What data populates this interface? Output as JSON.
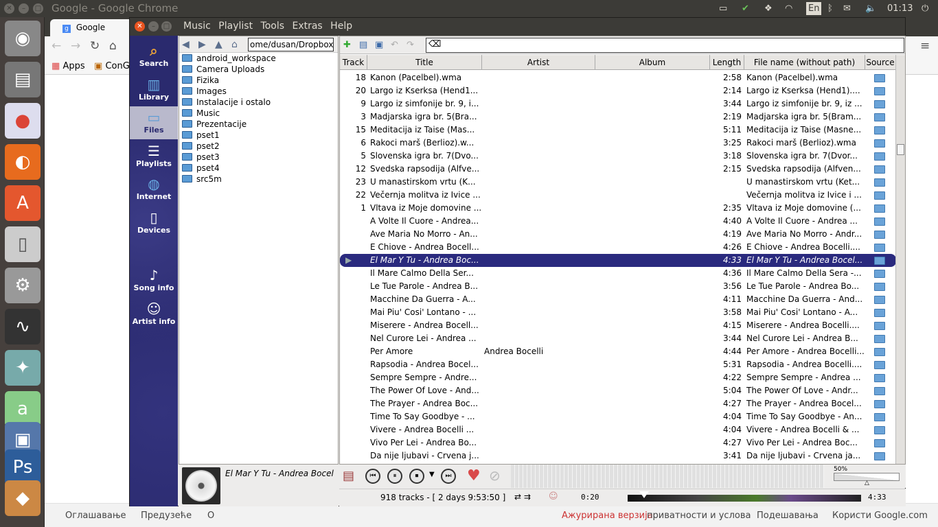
{
  "system": {
    "window_title": "Google - Google Chrome",
    "keyboard": "En",
    "clock": "01:13"
  },
  "launcher": {
    "apps": [
      "ubuntu-icon",
      "files-icon",
      "chrome-icon",
      "firefox-icon",
      "software-center-icon",
      "text-editor-icon",
      "settings-icon",
      "system-monitor-icon",
      "windows-icon",
      "android-icon",
      "vm-icon",
      "photoshop-icon",
      "app-icon"
    ]
  },
  "chrome": {
    "tab_title": "Google",
    "bookmarks": {
      "apps": "Apps",
      "item2": "ConG"
    },
    "footer": {
      "left": [
        "Оглашавање",
        "Предузеће",
        "О"
      ],
      "highlight": "Ажурирана верзија",
      "privacy": "приватности и услова",
      "settings": "Подешавања",
      "use": "Користи Google.com"
    }
  },
  "player": {
    "menu": [
      "Music",
      "Playlist",
      "Tools",
      "Extras",
      "Help"
    ],
    "sidebar": [
      {
        "label": "Search",
        "icon": "search-icon"
      },
      {
        "label": "Library",
        "icon": "library-icon"
      },
      {
        "label": "Files",
        "icon": "files-icon",
        "active": true
      },
      {
        "label": "Playlists",
        "icon": "playlists-icon"
      },
      {
        "label": "Internet",
        "icon": "internet-icon"
      },
      {
        "label": "Devices",
        "icon": "devices-icon"
      },
      {
        "label": "Song info",
        "icon": "song-info-icon"
      },
      {
        "label": "Artist info",
        "icon": "artist-info-icon"
      }
    ],
    "path": "ome/dusan/Dropbox",
    "folders": [
      "android_workspace",
      "Camera Uploads",
      "Fizika",
      "Images",
      "Instalacije i ostalo",
      "Music",
      "Prezentacije",
      "pset1",
      "pset2",
      "pset3",
      "pset4",
      "src5m"
    ],
    "columns": {
      "track": "Track",
      "title": "Title",
      "artist": "Artist",
      "album": "Album",
      "length": "Length",
      "file": "File name (without path)",
      "source": "Source"
    },
    "rows": [
      {
        "track": "18",
        "title": "Kanon (Pacelbel).wma",
        "artist": "",
        "length": "2:58",
        "file": "Kanon (Pacelbel).wma"
      },
      {
        "track": "20",
        "title": "Largo iz Kserksa (Hend1...",
        "artist": "",
        "length": "2:14",
        "file": "Largo iz Kserksa (Hend1)...."
      },
      {
        "track": "9",
        "title": "Largo iz simfonije br. 9, i...",
        "artist": "",
        "length": "3:44",
        "file": "Largo iz simfonije br. 9, iz ..."
      },
      {
        "track": "3",
        "title": "Madjarska igra br. 5(Bra...",
        "artist": "",
        "length": "2:19",
        "file": "Madjarska igra br. 5(Bram..."
      },
      {
        "track": "15",
        "title": "Meditacija iz Taise (Mas...",
        "artist": "",
        "length": "5:11",
        "file": "Meditacija iz Taise (Masne..."
      },
      {
        "track": "6",
        "title": "Rakoci marš (Berlioz).w...",
        "artist": "",
        "length": "3:25",
        "file": "Rakoci marš (Berlioz).wma"
      },
      {
        "track": "5",
        "title": "Slovenska igra br. 7(Dvo...",
        "artist": "",
        "length": "3:18",
        "file": "Slovenska igra br. 7(Dvor..."
      },
      {
        "track": "12",
        "title": "Svedska rapsodija (Alfve...",
        "artist": "",
        "length": "2:15",
        "file": "Svedska rapsodija (Alfven..."
      },
      {
        "track": "23",
        "title": "U manastirskom vrtu (K...",
        "artist": "",
        "length": "",
        "file": "U manastirskom vrtu (Ket..."
      },
      {
        "track": "22",
        "title": "Večernja molitva iz Ivice ...",
        "artist": "",
        "length": "",
        "file": "Večernja molitva iz Ivice i ..."
      },
      {
        "track": "1",
        "title": "Vltava iz Moje domovine ...",
        "artist": "",
        "length": "2:35",
        "file": "Vltava iz Moje domovine (..."
      },
      {
        "track": "",
        "title": "A Volte Il Cuore - Andrea...",
        "artist": "",
        "length": "4:40",
        "file": "A Volte Il Cuore - Andrea ..."
      },
      {
        "track": "",
        "title": "Ave Maria No Morro - An...",
        "artist": "",
        "length": "4:19",
        "file": "Ave Maria No Morro - Andr..."
      },
      {
        "track": "",
        "title": "E Chiove - Andrea Bocell...",
        "artist": "",
        "length": "4:26",
        "file": "E Chiove - Andrea Bocelli...."
      },
      {
        "track": "",
        "title": "El Mar Y Tu - Andrea Boc...",
        "artist": "",
        "length": "4:33",
        "file": "El Mar Y Tu - Andrea Bocel...",
        "playing": true
      },
      {
        "track": "",
        "title": "Il Mare Calmo Della Ser...",
        "artist": "",
        "length": "4:36",
        "file": "Il Mare Calmo Della Sera -..."
      },
      {
        "track": "",
        "title": "Le Tue Parole - Andrea B...",
        "artist": "",
        "length": "3:56",
        "file": "Le Tue Parole - Andrea Bo..."
      },
      {
        "track": "",
        "title": "Macchine Da Guerra - A...",
        "artist": "",
        "length": "4:11",
        "file": "Macchine Da Guerra - And..."
      },
      {
        "track": "",
        "title": "Mai Piu' Cosi' Lontano - ...",
        "artist": "",
        "length": "3:58",
        "file": "Mai Piu' Cosi' Lontano - A..."
      },
      {
        "track": "",
        "title": "Miserere - Andrea Bocell...",
        "artist": "",
        "length": "4:15",
        "file": "Miserere - Andrea Bocelli...."
      },
      {
        "track": "",
        "title": "Nel Curore Lei - Andrea ...",
        "artist": "",
        "length": "3:44",
        "file": "Nel Curore Lei - Andrea B..."
      },
      {
        "track": "",
        "title": "Per Amore",
        "artist": "Andrea Bocelli",
        "length": "4:44",
        "file": "Per Amore - Andrea Bocelli..."
      },
      {
        "track": "",
        "title": "Rapsodia - Andrea Bocel...",
        "artist": "",
        "length": "5:31",
        "file": "Rapsodia - Andrea Bocelli...."
      },
      {
        "track": "",
        "title": "Sempre Sempre - Andre...",
        "artist": "",
        "length": "4:22",
        "file": "Sempre Sempre - Andrea ..."
      },
      {
        "track": "",
        "title": "The Power Of Love - And...",
        "artist": "",
        "length": "5:04",
        "file": "The Power Of Love - Andr..."
      },
      {
        "track": "",
        "title": "The Prayer - Andrea Boc...",
        "artist": "",
        "length": "4:27",
        "file": "The Prayer - Andrea Bocel..."
      },
      {
        "track": "",
        "title": "Time To Say Goodbye - ...",
        "artist": "",
        "length": "4:04",
        "file": "Time To Say Goodbye - An..."
      },
      {
        "track": "",
        "title": "Vivere - Andrea Bocelli ...",
        "artist": "",
        "length": "4:04",
        "file": "Vivere - Andrea Bocelli & ..."
      },
      {
        "track": "",
        "title": "Vivo Per Lei - Andrea Bo...",
        "artist": "",
        "length": "4:27",
        "file": "Vivo Per Lei - Andrea Boc..."
      },
      {
        "track": "",
        "title": "Da nije ljubavi - Crvena j...",
        "artist": "",
        "length": "3:41",
        "file": "Da nije ljubavi - Crvena ja..."
      }
    ],
    "now_playing": "El Mar Y Tu - Andrea Bocel",
    "volume": "50%",
    "status": "918 tracks - [ 2 days 9:53:50 ]",
    "elapsed": "0:20",
    "total": "4:33",
    "progress": 0.07
  }
}
